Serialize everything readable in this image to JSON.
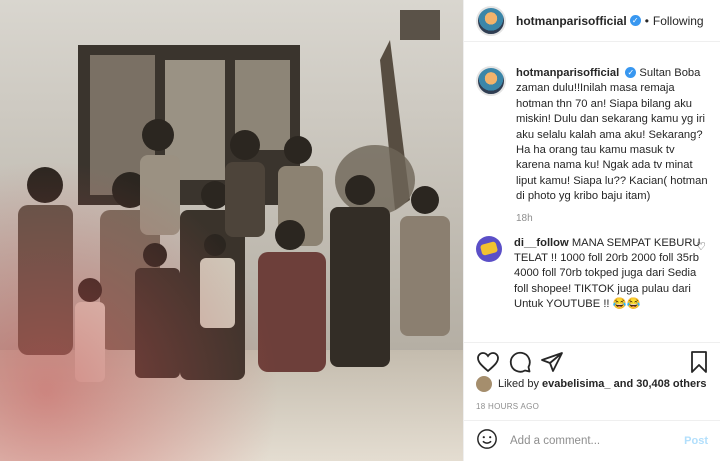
{
  "photo": {
    "alt_icon": "family-photo"
  },
  "header": {
    "username": "hotmanparisofficial",
    "verified_icon": "verified-badge-icon",
    "separator": "•",
    "follow_state": "Following"
  },
  "caption": {
    "username": "hotmanparisofficial",
    "text": "Sultan Boba zaman dulu!!Inilah masa remaja hotman thn 70 an! Siapa bilang aku miskin! Dulu dan sekarang kamu yg iri aku selalu kalah ama aku! Sekarang? Ha ha orang tau kamu masuk tv karena nama ku! Ngak ada tv minat liput kamu! Siapa lu?? Kacian( hotman di photo yg kribo baju itam)",
    "time": "18h"
  },
  "comments": [
    {
      "username": "di__follow",
      "text": "MANA SEMPAT KEBURU TELAT !! 1000 foll 20rb 2000 foll 35rb 4000 foll 70rb tokped juga dari Sedia foll shopee! TIKTOK juga pulau dari Untuk YOUTUBE !! 😂😂"
    }
  ],
  "likes": {
    "prefix": "Liked by",
    "user": "evabelisima_",
    "rest": "and 30,408 others"
  },
  "post_time": "18 HOURS AGO",
  "add_comment": {
    "placeholder": "Add a comment...",
    "post_label": "Post"
  },
  "colors": {
    "link_blue": "#3897f0",
    "post_disabled": "#b2dffc",
    "muted": "#8e8e8e"
  }
}
